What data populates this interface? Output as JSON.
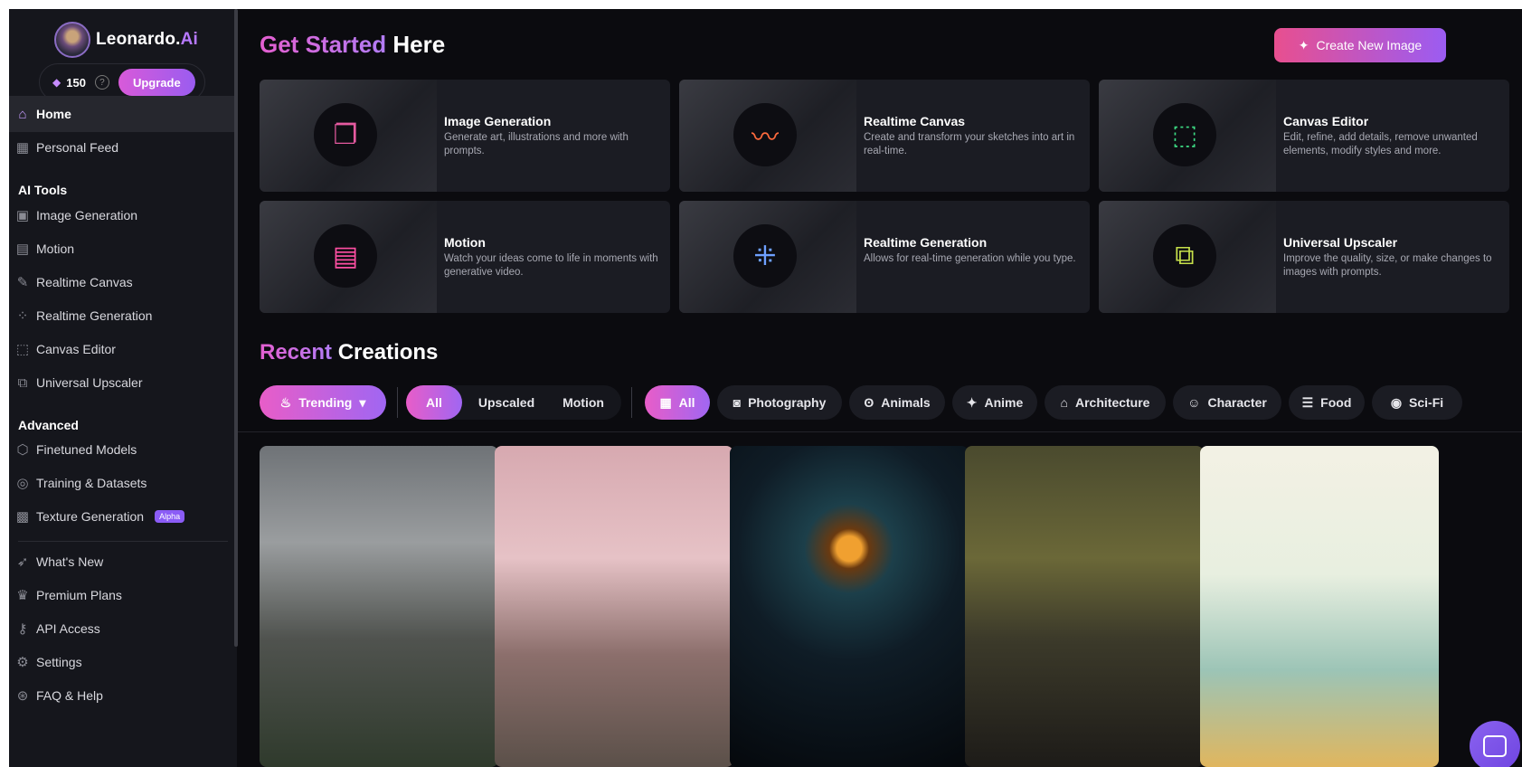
{
  "app": {
    "brand": "Leonardo.",
    "brand_ai": "Ai"
  },
  "credits": {
    "amount": "150",
    "help": "?",
    "upgrade_label": "Upgrade"
  },
  "sidebar": {
    "home": "Home",
    "personal_feed": "Personal Feed",
    "ai_tools_header": "AI Tools",
    "ai_tools": [
      {
        "label": "Image Generation",
        "icon": "image-icon"
      },
      {
        "label": "Motion",
        "icon": "film-icon"
      },
      {
        "label": "Realtime Canvas",
        "icon": "brush-icon"
      },
      {
        "label": "Realtime Generation",
        "icon": "grid-dots-icon"
      },
      {
        "label": "Canvas Editor",
        "icon": "crop-icon"
      },
      {
        "label": "Universal Upscaler",
        "icon": "upscale-icon"
      }
    ],
    "advanced_header": "Advanced",
    "advanced": [
      {
        "label": "Finetuned Models",
        "icon": "cube-icon"
      },
      {
        "label": "Training & Datasets",
        "icon": "dataset-icon"
      },
      {
        "label": "Texture Generation",
        "icon": "texture-icon",
        "badge": "Alpha"
      }
    ],
    "bottom": [
      {
        "label": "What's New",
        "icon": "rocket-icon"
      },
      {
        "label": "Premium Plans",
        "icon": "crown-icon"
      },
      {
        "label": "API Access",
        "icon": "key-icon"
      },
      {
        "label": "Settings",
        "icon": "gear-icon"
      },
      {
        "label": "FAQ & Help",
        "icon": "help-icon"
      }
    ]
  },
  "header": {
    "title_accent": "Get Started",
    "title_rest": "Here",
    "create_button": "Create New Image"
  },
  "cards": [
    {
      "title": "Image Generation",
      "desc": "Generate art, illustrations and more with prompts.",
      "icon": "image-stack-icon",
      "color": "#e55aa0"
    },
    {
      "title": "Realtime Canvas",
      "desc": "Create and transform your sketches into art in real-time.",
      "icon": "squiggle-icon",
      "color": "#ff6a3d"
    },
    {
      "title": "Canvas Editor",
      "desc": "Edit, refine, add details, remove unwanted elements, modify styles and more.",
      "icon": "crop-square-icon",
      "color": "#3ddc84"
    },
    {
      "title": "Motion",
      "desc": "Watch your ideas come to life in moments with generative video.",
      "icon": "film-strip-icon",
      "color": "#ff4fa3"
    },
    {
      "title": "Realtime Generation",
      "desc": "Allows for real-time generation while you type.",
      "icon": "grid-plus-icon",
      "color": "#6ea0ff"
    },
    {
      "title": "Universal Upscaler",
      "desc": "Improve the quality, size, or make changes to images with prompts.",
      "icon": "upscale-frame-icon",
      "color": "#c6e04a"
    }
  ],
  "recent": {
    "title_accent": "Recent",
    "title_rest": "Creations"
  },
  "filters": {
    "sort": "Trending",
    "types": [
      "All",
      "Upscaled",
      "Motion"
    ],
    "categories": [
      "All",
      "Photography",
      "Animals",
      "Anime",
      "Architecture",
      "Character",
      "Food",
      "Sci-Fi"
    ]
  }
}
